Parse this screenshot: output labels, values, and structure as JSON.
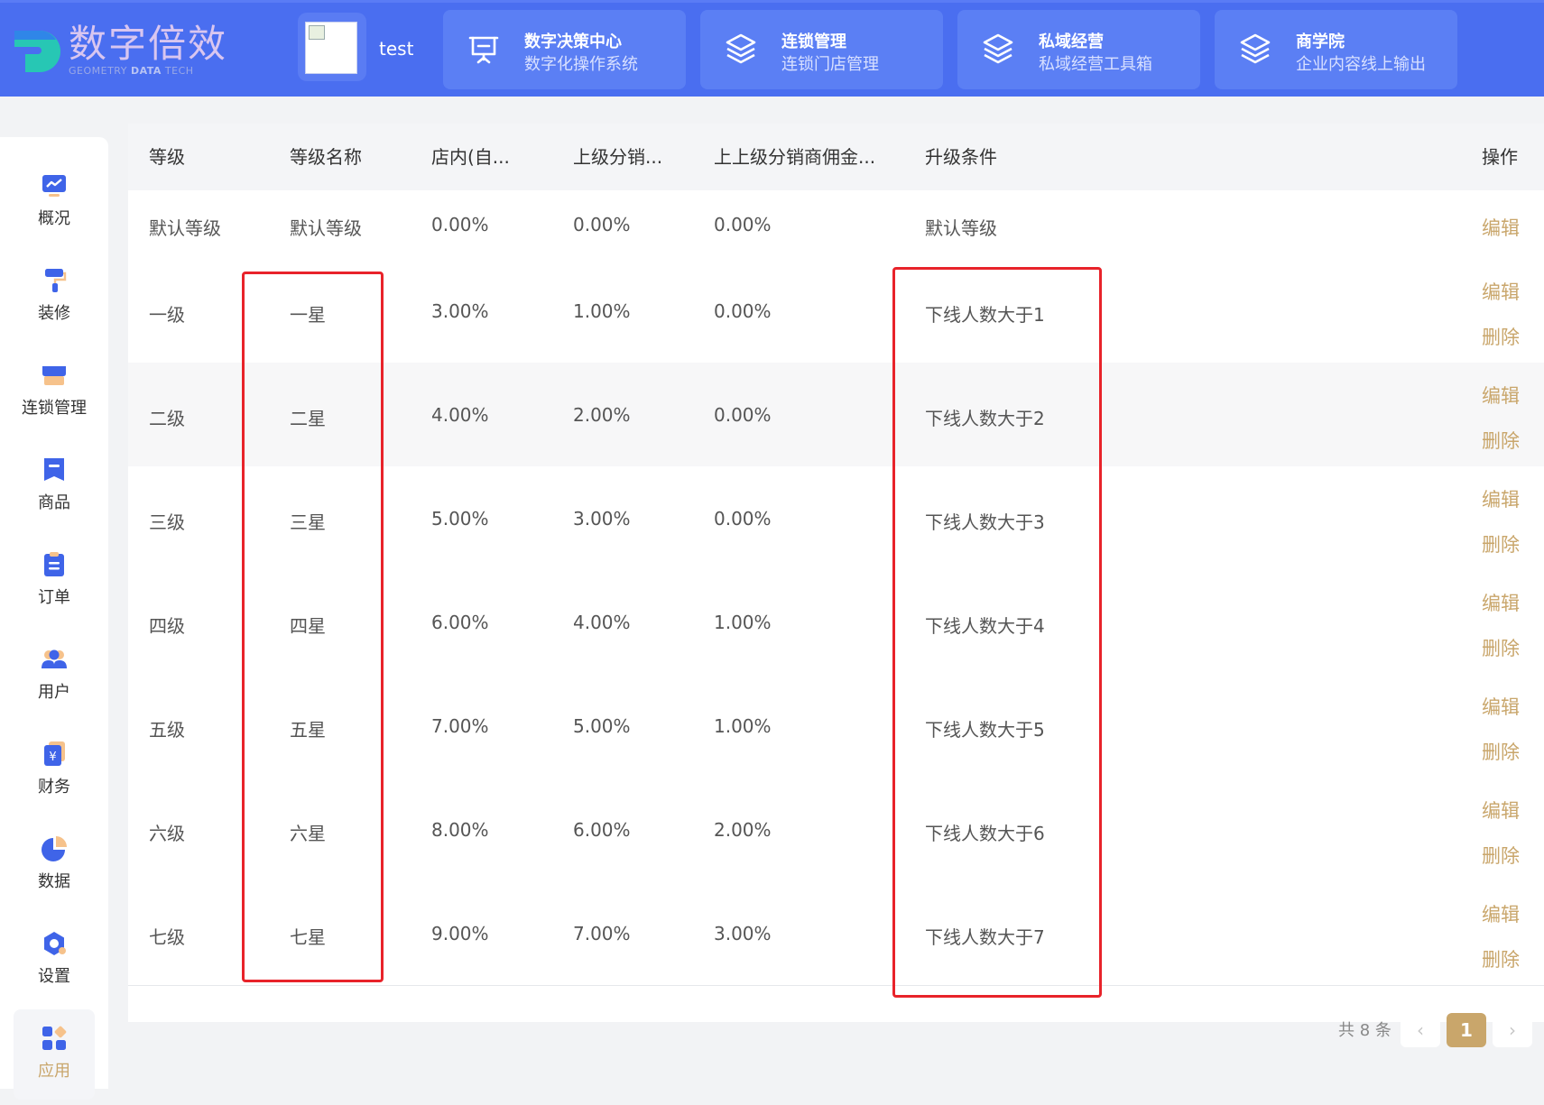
{
  "header": {
    "logo_title": "数字倍效",
    "logo_sub_a": "GEOMETRY",
    "logo_sub_b": "DATA",
    "logo_sub_c": "TECH",
    "user_name": "test",
    "nav_cards": [
      {
        "title": "数字决策中心",
        "sub": "数字化操作系统",
        "icon": "presentation-board-icon"
      },
      {
        "title": "连锁管理",
        "sub": "连锁门店管理",
        "icon": "layers-icon"
      },
      {
        "title": "私域经营",
        "sub": "私域经营工具箱",
        "icon": "layers-icon"
      },
      {
        "title": "商学院",
        "sub": "企业内容线上输出",
        "icon": "layers-icon"
      }
    ]
  },
  "sidebar": {
    "items": [
      {
        "label": "概况",
        "icon": "chart-monitor-icon"
      },
      {
        "label": "装修",
        "icon": "paint-roller-icon"
      },
      {
        "label": "连锁管理",
        "icon": "storefront-icon"
      },
      {
        "label": "商品",
        "icon": "product-tag-icon"
      },
      {
        "label": "订单",
        "icon": "clipboard-icon"
      },
      {
        "label": "用户",
        "icon": "users-icon"
      },
      {
        "label": "财务",
        "icon": "yuan-wallet-icon"
      },
      {
        "label": "数据",
        "icon": "pie-chart-icon"
      },
      {
        "label": "设置",
        "icon": "gear-icon"
      },
      {
        "label": "应用",
        "icon": "apps-grid-icon"
      }
    ],
    "active_index": 9
  },
  "table": {
    "headers": [
      "等级",
      "等级名称",
      "店内(自...",
      "上级分销...",
      "上上级分销商佣金...",
      "升级条件",
      "操作"
    ],
    "edit_label": "编辑",
    "delete_label": "删除",
    "rows": [
      {
        "level": "默认等级",
        "name": "默认等级",
        "store": "0.00%",
        "parent": "0.00%",
        "grandparent": "0.00%",
        "condition": "默认等级",
        "deletable": false
      },
      {
        "level": "一级",
        "name": "一星",
        "store": "3.00%",
        "parent": "1.00%",
        "grandparent": "0.00%",
        "condition": "下线人数大于1",
        "deletable": true
      },
      {
        "level": "二级",
        "name": "二星",
        "store": "4.00%",
        "parent": "2.00%",
        "grandparent": "0.00%",
        "condition": "下线人数大于2",
        "deletable": true
      },
      {
        "level": "三级",
        "name": "三星",
        "store": "5.00%",
        "parent": "3.00%",
        "grandparent": "0.00%",
        "condition": "下线人数大于3",
        "deletable": true
      },
      {
        "level": "四级",
        "name": "四星",
        "store": "6.00%",
        "parent": "4.00%",
        "grandparent": "1.00%",
        "condition": "下线人数大于4",
        "deletable": true
      },
      {
        "level": "五级",
        "name": "五星",
        "store": "7.00%",
        "parent": "5.00%",
        "grandparent": "1.00%",
        "condition": "下线人数大于5",
        "deletable": true
      },
      {
        "level": "六级",
        "name": "六星",
        "store": "8.00%",
        "parent": "6.00%",
        "grandparent": "2.00%",
        "condition": "下线人数大于6",
        "deletable": true
      },
      {
        "level": "七级",
        "name": "七星",
        "store": "9.00%",
        "parent": "7.00%",
        "grandparent": "3.00%",
        "condition": "下线人数大于7",
        "deletable": true
      }
    ]
  },
  "pagination": {
    "total_text": "共 8 条",
    "current_page": "1",
    "prev_glyph": "‹",
    "next_glyph": "›"
  },
  "colors": {
    "header_bg": "#4a6ef0",
    "accent_gold": "#c9a66b",
    "highlight_red": "#e8232a"
  }
}
